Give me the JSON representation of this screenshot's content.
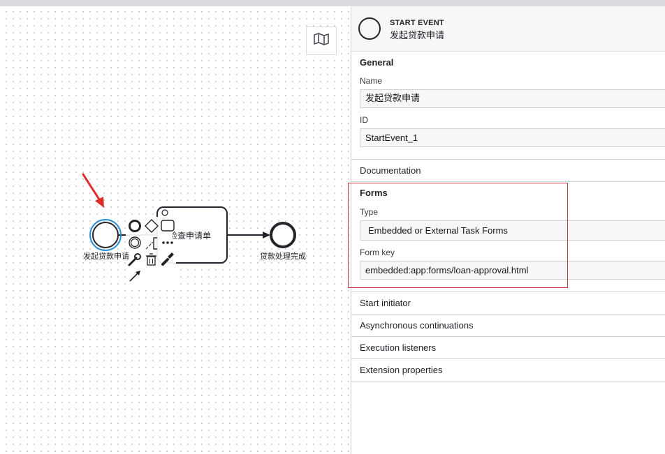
{
  "diagram": {
    "start_event_label": "发起贷款申请",
    "task_label": "检查申请单",
    "end_event_label": "贷款处理完成"
  },
  "context_pad": {
    "items": [
      "end-event",
      "gateway",
      "task",
      "intermediate-event",
      "text-annotation",
      "more",
      "change-type",
      "delete",
      "color",
      "connect"
    ]
  },
  "colors": {
    "selection": "#2a8fd8",
    "highlight": "#d0364a",
    "arrow": "#e02b2b"
  },
  "panel": {
    "header": {
      "type": "START EVENT",
      "name": "发起贷款申请"
    },
    "general": {
      "title": "General",
      "name_label": "Name",
      "name_value": "发起贷款申请",
      "id_label": "ID",
      "id_value": "StartEvent_1"
    },
    "documentation": {
      "title": "Documentation"
    },
    "forms": {
      "title": "Forms",
      "type_label": "Type",
      "type_value": "Embedded or External Task Forms",
      "key_label": "Form key",
      "key_value": "embedded:app:forms/loan-approval.html"
    },
    "start_initiator": {
      "title": "Start initiator"
    },
    "async": {
      "title": "Asynchronous continuations"
    },
    "exec_listeners": {
      "title": "Execution listeners"
    },
    "ext_props": {
      "title": "Extension properties"
    }
  }
}
